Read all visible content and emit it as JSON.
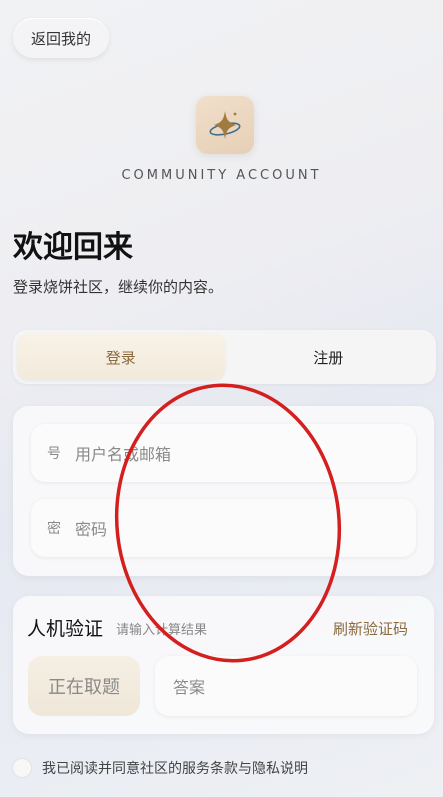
{
  "header": {
    "back_label": "返回我的",
    "brand": "COMMUNITY ACCOUNT",
    "logo_icon": "sparkle-ring-icon"
  },
  "hero": {
    "title": "欢迎回来",
    "subtitle": "登录烧饼社区，继续你的内容。"
  },
  "tabs": [
    {
      "label": "登录",
      "active": true
    },
    {
      "label": "注册",
      "active": false
    }
  ],
  "form": {
    "username": {
      "prefix": "号",
      "placeholder": "用户名或邮箱"
    },
    "password": {
      "prefix": "密",
      "placeholder": "密码"
    }
  },
  "captcha": {
    "title": "人机验证",
    "hint": "请输入计算结果",
    "refresh_label": "刷新验证码",
    "question": "正在取题",
    "answer_placeholder": "答案"
  },
  "agreement": {
    "text": "我已阅读并同意社区的服务条款与隐私说明"
  },
  "colors": {
    "accent": "#8a6a3e",
    "annotation": "#d41f1f"
  }
}
